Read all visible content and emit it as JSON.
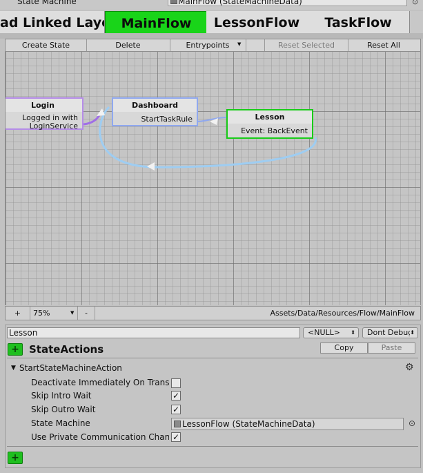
{
  "top": {
    "label": "State Machine",
    "value": "MainFlow (StateMachineData)",
    "target_icon": "⊙"
  },
  "tabs": [
    {
      "label": "ad Linked Layers",
      "active": false
    },
    {
      "label": "MainFlow",
      "active": true
    },
    {
      "label": "LessonFlow",
      "active": false
    },
    {
      "label": "TaskFlow",
      "active": false
    }
  ],
  "toolbar": {
    "create_state": "Create State",
    "delete": "Delete",
    "entrypoints": "Entrypoints",
    "reset_selected": "Reset Selected",
    "reset_all": "Reset All"
  },
  "graph": {
    "nodes": {
      "login": {
        "title": "Login",
        "line1": "Logged in with",
        "line2": "LoginService"
      },
      "dashboard": {
        "title": "Dashboard",
        "line1": "StartTaskRule"
      },
      "lesson": {
        "title": "Lesson",
        "line1": "Event: BackEvent"
      }
    },
    "colors": {
      "login": "#b58ce8",
      "dashboard": "#8fa8ef",
      "lesson": "#18cc18",
      "transition": "#9ecdf2",
      "login_link": "#a06ee6"
    }
  },
  "bottombar": {
    "plus": "+",
    "zoom": "75%",
    "minus": "-",
    "path": "Assets/Data/Resources/Flow/MainFlow"
  },
  "inspector": {
    "state_name": "Lesson",
    "null_popup": "<NULL>",
    "debug_popup": "Dont Debug",
    "add_label": "+",
    "state_actions_title": "StateActions",
    "copy": "Copy",
    "paste": "Paste",
    "action_title": "StartStateMachineAction",
    "props": {
      "deactivate": {
        "label": "Deactivate Immediately On Transition",
        "checked": false
      },
      "skip_intro": {
        "label": "Skip Intro Wait",
        "checked": true
      },
      "skip_outro": {
        "label": "Skip Outro Wait",
        "checked": true
      },
      "state_machine": {
        "label": "State Machine",
        "value": "LessonFlow (StateMachineData)"
      },
      "private_comm": {
        "label": "Use Private Communication Channel",
        "checked": true
      }
    },
    "check_glyph": "✓",
    "target_icon": "⊙"
  }
}
